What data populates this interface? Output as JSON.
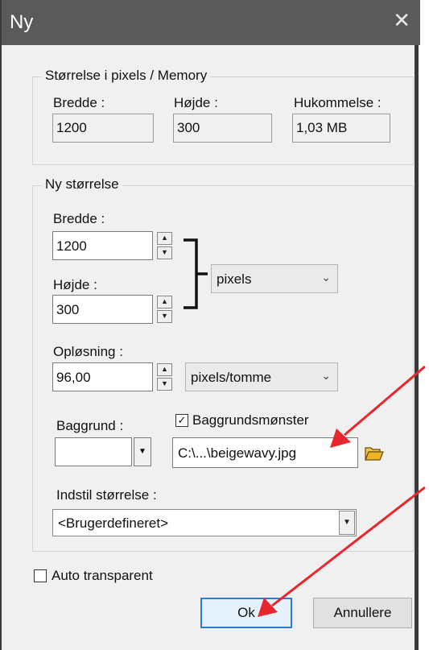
{
  "window": {
    "title": "Ny",
    "close_glyph": "✕"
  },
  "memory_group": {
    "legend": "Størrelse i pixels / Memory",
    "width_label": "Bredde :",
    "width_value": "1200",
    "height_label": "Højde :",
    "height_value": "300",
    "memory_label": "Hukommelse :",
    "memory_value": "1,03 MB"
  },
  "new_size_group": {
    "legend": "Ny størrelse",
    "width_label": "Bredde :",
    "width_value": "1200",
    "height_label": "Højde :",
    "height_value": "300",
    "unit_select": "pixels",
    "resolution_label": "Opløsning :",
    "resolution_value": "96,00",
    "resolution_unit_select": "pixels/tomme",
    "background_label": "Baggrund :",
    "background_color": "#ffffff",
    "pattern_checkbox_label": "Baggrundsmønster",
    "pattern_checked": true,
    "pattern_file": "C:\\...\\beigewavy.jpg",
    "preset_label": "Indstil størrelse :",
    "preset_value": "<Brugerdefineret>"
  },
  "auto_transparent_label": "Auto transparent",
  "auto_transparent_checked": false,
  "buttons": {
    "ok": "Ok",
    "cancel": "Annullere"
  },
  "annotation_color": "#e8262d",
  "icons": [
    "close-icon",
    "spin-up-icon",
    "spin-down-icon",
    "chevron-down-icon",
    "folder-open-icon",
    "checkmark-icon",
    "arrow-annotation"
  ]
}
